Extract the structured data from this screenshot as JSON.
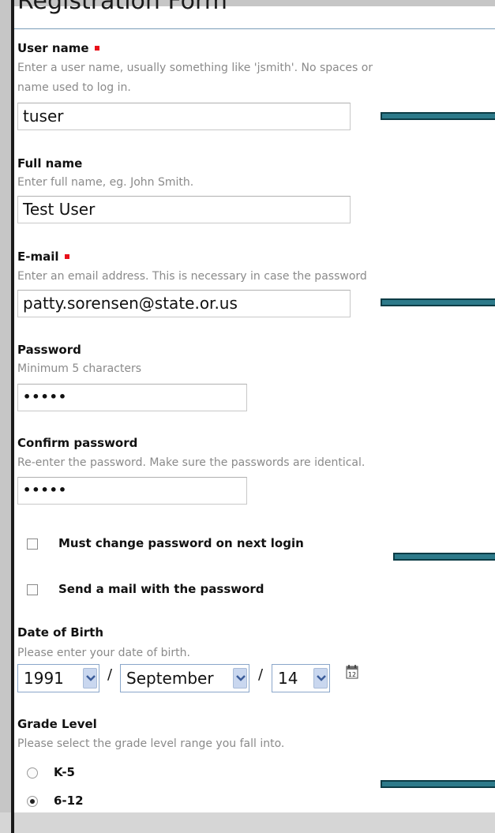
{
  "form": {
    "title": "Registration Form"
  },
  "fields": {
    "username": {
      "label": "User name",
      "help_line1": "Enter a user name, usually something like 'jsmith'. No spaces or",
      "help_line2": "name used to log in.",
      "value": "tuser",
      "required": true
    },
    "fullname": {
      "label": "Full name",
      "help": "Enter full name, eg. John Smith.",
      "value": "Test User"
    },
    "email": {
      "label": "E-mail",
      "help": "Enter an email address. This is necessary in case the password",
      "value": "patty.sorensen@state.or.us",
      "required": true
    },
    "password": {
      "label": "Password",
      "help": "Minimum 5 characters",
      "value": "•••••"
    },
    "confirm": {
      "label": "Confirm password",
      "help": "Re-enter the password. Make sure the passwords are identical.",
      "value": "•••••"
    }
  },
  "checkboxes": {
    "must_change": {
      "label": "Must change password on next login",
      "checked": false
    },
    "send_mail": {
      "label": "Send a mail with the password",
      "checked": false
    }
  },
  "dob": {
    "label": "Date of Birth",
    "help": "Please enter your date of birth.",
    "year": "1991",
    "month": "September",
    "day": "14",
    "separator": "/"
  },
  "grade": {
    "label": "Grade Level",
    "help": "Please select the grade level range you fall into.",
    "options": [
      {
        "label": "K-5",
        "selected": false
      },
      {
        "label": "6-12",
        "selected": true
      }
    ]
  },
  "colors": {
    "required_marker": "#e8101a",
    "annotation_bar": "#2d7a8a",
    "help_text": "#8a8a8a"
  },
  "icons": {
    "calendar": "calendar-icon",
    "dropdown": "chevron-down-icon"
  }
}
